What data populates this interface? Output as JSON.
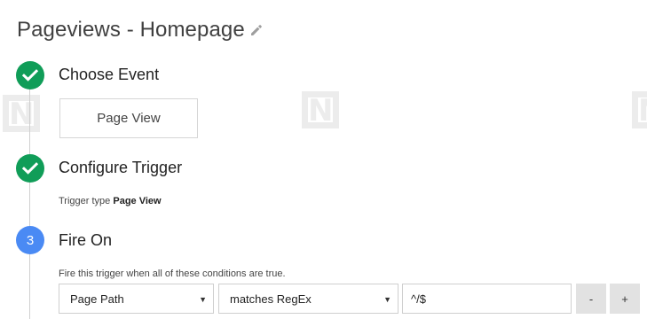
{
  "page": {
    "title": "Pageviews - Homepage"
  },
  "icons": {
    "edit": "pencil-icon",
    "done": "checkmark-icon"
  },
  "colors": {
    "done_step": "#109d58",
    "active_step": "#4a8af4",
    "button_bg": "#e2e2e2"
  },
  "steps": [
    {
      "label": "Choose Event",
      "status": "done",
      "event_option": "Page View"
    },
    {
      "label": "Configure Trigger",
      "status": "done",
      "trigger_type_prefix": "Trigger type",
      "trigger_type_value": "Page View"
    },
    {
      "label": "Fire On",
      "status": "active",
      "number": "3",
      "condition_text": "Fire this trigger when all of these conditions are true."
    }
  ],
  "condition": {
    "variable": "Page Path",
    "operator": "matches RegEx",
    "value": "^/$",
    "remove_label": "-",
    "add_label": "+"
  }
}
